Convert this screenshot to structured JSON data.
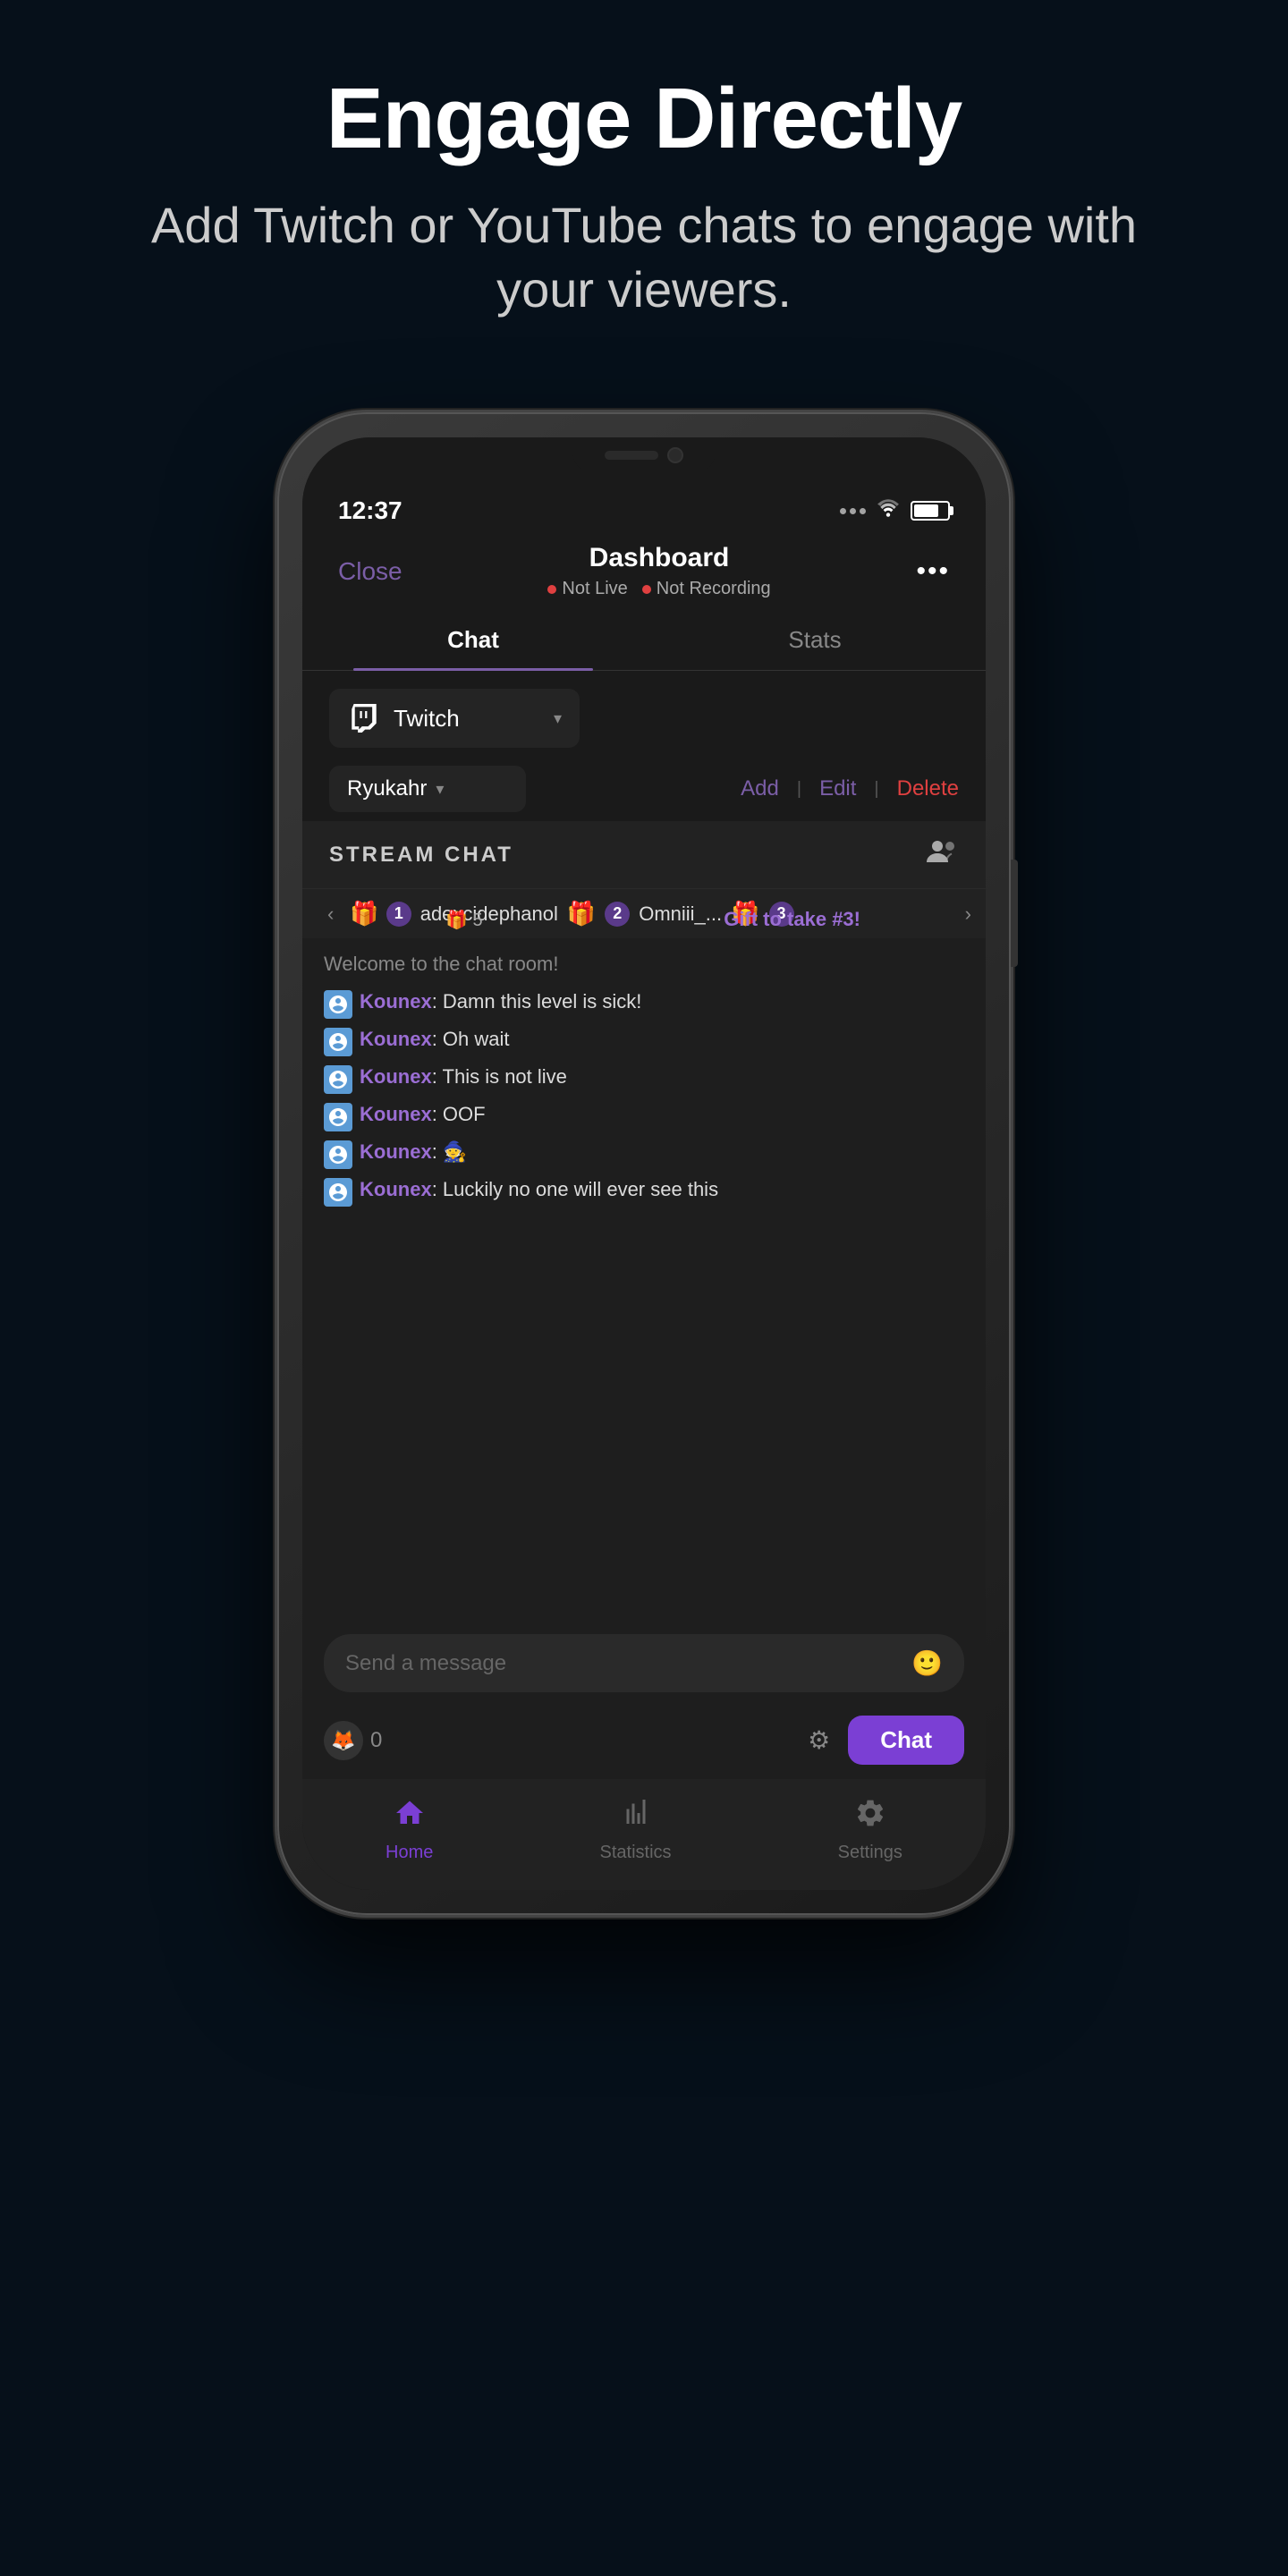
{
  "header": {
    "title": "Engage Directly",
    "subtitle": "Add Twitch or YouTube chats to\nengage with your viewers."
  },
  "phone": {
    "statusBar": {
      "time": "12:37",
      "icons": [
        "signal",
        "wifi",
        "battery"
      ]
    },
    "nav": {
      "closeLabel": "Close",
      "title": "Dashboard",
      "statusLive": "Not Live",
      "statusRecording": "Not Recording",
      "moreLabel": "•••"
    },
    "tabs": [
      {
        "label": "Chat",
        "active": true
      },
      {
        "label": "Stats",
        "active": false
      }
    ],
    "platformSelector": {
      "platform": "Twitch",
      "channel": "Ryukahr"
    },
    "channelActions": {
      "add": "Add",
      "edit": "Edit",
      "delete": "Delete"
    },
    "streamChat": {
      "title": "STREAM CHAT"
    },
    "giftBanner": {
      "user": "adexcidephanol",
      "badge1": "1",
      "icon2": "🎁",
      "badge2": "2",
      "user2": "Omniii_...",
      "icon3": "🎁",
      "badge3": "3",
      "giftCount": "5",
      "giftTake": "Gift to take #3!"
    },
    "welcomeMsg": "Welcome to the chat room!",
    "messages": [
      {
        "username": "Kounex",
        "text": ": Damn this level is sick!"
      },
      {
        "username": "Kounex",
        "text": ": Oh wait"
      },
      {
        "username": "Kounex",
        "text": ": This is not live"
      },
      {
        "username": "Kounex",
        "text": ": OOF"
      },
      {
        "username": "Kounex",
        "text": ": 🧙"
      },
      {
        "username": "Kounex",
        "text": ": Luckily no one will ever see this"
      }
    ],
    "messageInput": {
      "placeholder": "Send a message"
    },
    "bottomBar": {
      "pointCount": "0",
      "chatButton": "Chat"
    },
    "bottomNav": [
      {
        "label": "Home",
        "active": true
      },
      {
        "label": "Statistics",
        "active": false
      },
      {
        "label": "Settings",
        "active": false
      }
    ]
  }
}
